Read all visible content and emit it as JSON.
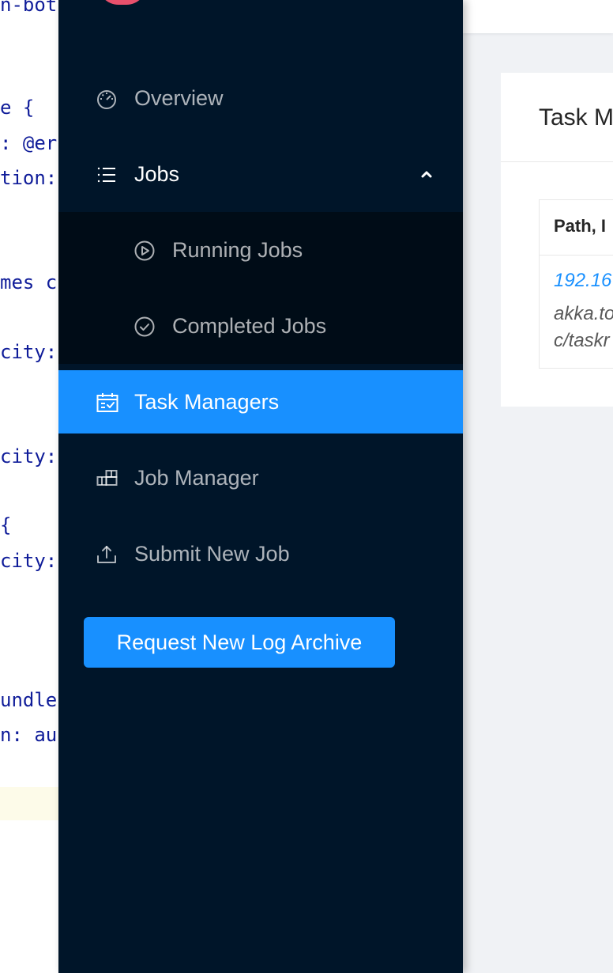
{
  "editor": {
    "lines": [
      "n-bot",
      "e {",
      ": @er",
      "tion:",
      "mes c",
      "city:",
      "city:",
      "{",
      "city:",
      "undle",
      "n: au"
    ]
  },
  "card": {
    "title": "Task M",
    "table": {
      "header": "Path, I",
      "row": [
        "192.16",
        "akka.to",
        "c/taskr"
      ]
    }
  },
  "sidebar": {
    "items": [
      {
        "label": "Overview",
        "icon": "dashboard-icon"
      },
      {
        "label": "Jobs",
        "icon": "unordered-list-icon",
        "expanded": true
      },
      {
        "label": "Running Jobs",
        "icon": "play-circle-icon"
      },
      {
        "label": "Completed Jobs",
        "icon": "check-circle-icon"
      },
      {
        "label": "Task Managers",
        "icon": "schedule-icon",
        "selected": true
      },
      {
        "label": "Job Manager",
        "icon": "build-icon"
      },
      {
        "label": "Submit New Job",
        "icon": "upload-icon"
      }
    ],
    "archive_button": "Request New Log Archive"
  },
  "colors": {
    "sidebar_bg": "#001529",
    "submenu_bg": "#000c17",
    "accent": "#1890ff"
  }
}
